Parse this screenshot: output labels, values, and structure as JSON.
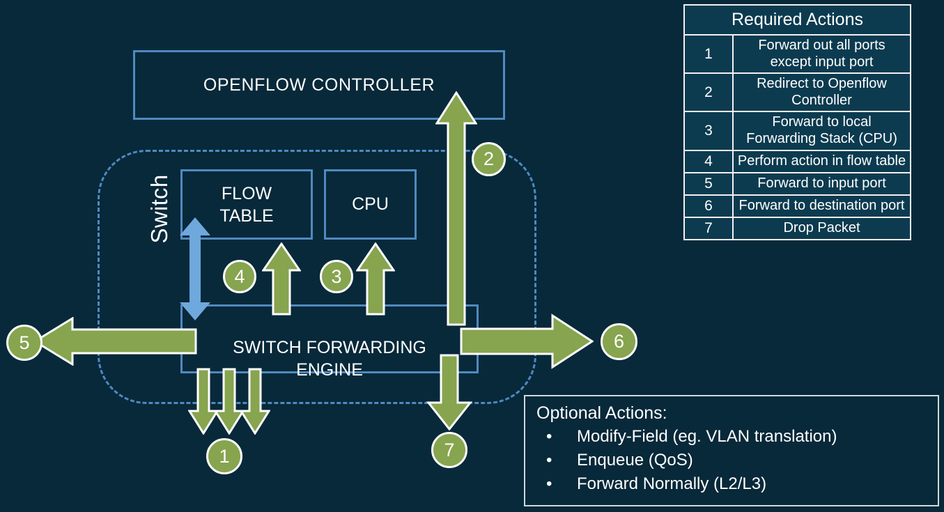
{
  "diagram": {
    "controller": {
      "label": "OPENFLOW CONTROLLER"
    },
    "switch": {
      "label": "Switch"
    },
    "flow_table": {
      "line1": "FLOW",
      "line2": "TABLE"
    },
    "cpu": {
      "label": "CPU"
    },
    "engine": {
      "line1": "SWITCH FORWARDING",
      "line2": "ENGINE"
    },
    "markers": {
      "m1": "1",
      "m2": "2",
      "m3": "3",
      "m4": "4",
      "m5": "5",
      "m6": "6",
      "m7": "7"
    },
    "colors": {
      "background": "#07293a",
      "arrow_green": "#87a44f",
      "arrow_blue": "#6fa8dc",
      "box_border_blue": "#5189bf",
      "table_border": "#f2f2f2",
      "table_cell_bg": "#0c3b50",
      "text": "#ffffff"
    }
  },
  "actions_table": {
    "title": "Required Actions",
    "rows": [
      {
        "num": "1",
        "desc": "Forward out all ports except input port"
      },
      {
        "num": "2",
        "desc": "Redirect to Openflow Controller"
      },
      {
        "num": "3",
        "desc": "Forward to local Forwarding Stack (CPU)"
      },
      {
        "num": "4",
        "desc": "Perform action in flow table"
      },
      {
        "num": "5",
        "desc": "Forward to input port"
      },
      {
        "num": "6",
        "desc": "Forward to destination port"
      },
      {
        "num": "7",
        "desc": "Drop Packet"
      }
    ]
  },
  "optional_actions": {
    "title": "Optional Actions:",
    "bullet": "•",
    "items": [
      "Modify-Field (eg. VLAN translation)",
      "Enqueue (QoS)",
      "Forward Normally (L2/L3)"
    ]
  }
}
